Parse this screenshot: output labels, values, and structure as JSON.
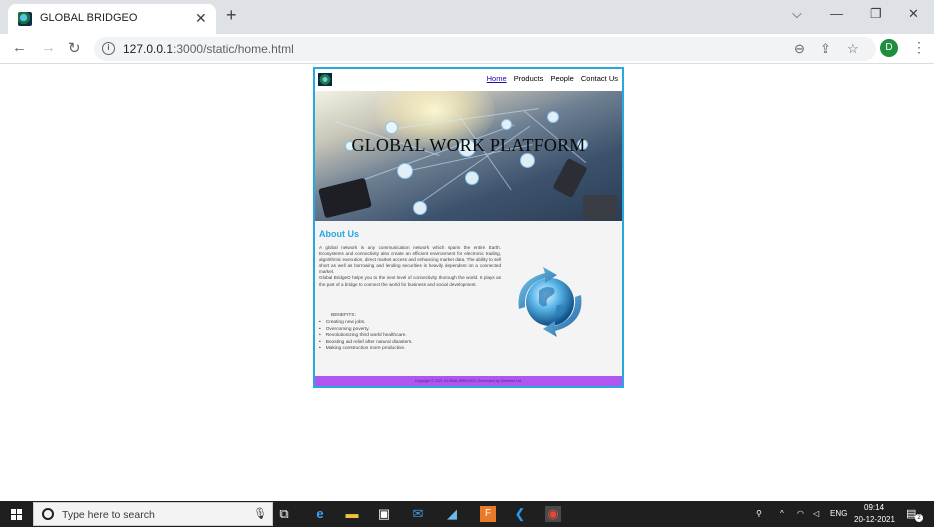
{
  "browser": {
    "tab_title": "GLOBAL BRIDGEO",
    "tab_close": "✕",
    "new_tab": "+",
    "url_host": "127.0.0.1",
    "url_rest": ":3000/static/home.html",
    "avatar_letter": "D",
    "window": {
      "chevron": "⌵",
      "minimize": "—",
      "restore": "❐",
      "close": "✕"
    }
  },
  "site": {
    "nav": [
      {
        "label": "Home",
        "active": true
      },
      {
        "label": "Products",
        "active": false
      },
      {
        "label": "People",
        "active": false
      },
      {
        "label": "Contact Us",
        "active": false
      }
    ],
    "hero_title": "GLOBAL WORK PLATFORM",
    "about": {
      "title": "About Us",
      "paragraph1": "A global network is any communication network which spans the entire Earth. Ecosystems and connectivity also create an efficient environment for electronic trading, algorithmic execution, direct market access and enhancing market data. The ability to sell short as well as borrowing and lending securities is heavily dependent on a connected market.",
      "paragraph2": "Global BridgeO helps you to the next level of connectivity thorough the world. It plays as the part of a bridge to connect the world for business and social development.",
      "benefits_title": "BENEFITS:",
      "benefits": [
        "Creating new jobs.",
        "Overcoming poverty.",
        "Revolutionizing third world healthcare.",
        "Boosting aid relief after natural disasters.",
        "Making construction more productive."
      ]
    },
    "footer": "Copyright © 2021 GLOBAL BRIDGEO. Developed by Dheemm Ltd."
  },
  "taskbar": {
    "search_placeholder": "Type here to search",
    "language": "ENG",
    "time": "09:14",
    "date": "20-12-2021",
    "notification_count": "2"
  },
  "colors": {
    "accent": "#29a8e0",
    "footer": "#b056f0",
    "avatar": "#1e8e3e"
  }
}
